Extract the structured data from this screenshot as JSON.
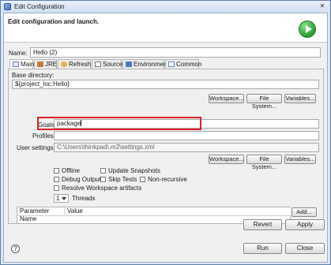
{
  "window": {
    "title": "Edit Configuration",
    "close_glyph": "✕"
  },
  "header": {
    "title": "Edit configuration and launch.",
    "run_icon": "run-icon"
  },
  "name": {
    "label": "Name:",
    "value": "Hello (2)"
  },
  "tabs": [
    {
      "label": "Main",
      "icon": "main-tab-icon",
      "active": true
    },
    {
      "label": "JRE",
      "icon": "jre-icon"
    },
    {
      "label": "Refresh",
      "icon": "refresh-icon"
    },
    {
      "label": "Source",
      "icon": "source-icon"
    },
    {
      "label": "Environment",
      "icon": "environment-icon"
    },
    {
      "label": "Common",
      "icon": "common-icon"
    }
  ],
  "main": {
    "base_dir_label": "Base directory:",
    "base_dir_value": "${project_loc:Hello}",
    "workspace_btn": "Workspace...",
    "filesystem_btn": "File System...",
    "variables_btn": "Variables...",
    "goals_label": "Goals:",
    "goals_value": "package",
    "profiles_label": "Profiles:",
    "profiles_value": "",
    "user_settings_label": "User settings:",
    "user_settings_value": "C:\\Users\\thinkpad\\.m2\\settings.xml",
    "workspace_btn2": "Workspace...",
    "filesystem_btn2": "File System...",
    "variables_btn2": "Variables...",
    "checkboxes": {
      "offline": "Offline",
      "update_snapshots": "Update Snapshots",
      "debug_output": "Debug Output",
      "skip_tests": "Skip Tests",
      "non_recursive": "Non-recursive",
      "resolve_workspace": "Resolve Workspace artifacts"
    },
    "threads_value": "1",
    "threads_label": "Threads",
    "params_columns": [
      "Parameter Name",
      "Value"
    ],
    "add_btn": "Add..."
  },
  "footer": {
    "revert": "Revert",
    "apply": "Apply",
    "run": "Run",
    "close": "Close",
    "help_glyph": "?"
  },
  "colors": {
    "highlight": "#e0202a",
    "accent": "#3f6fb0"
  }
}
